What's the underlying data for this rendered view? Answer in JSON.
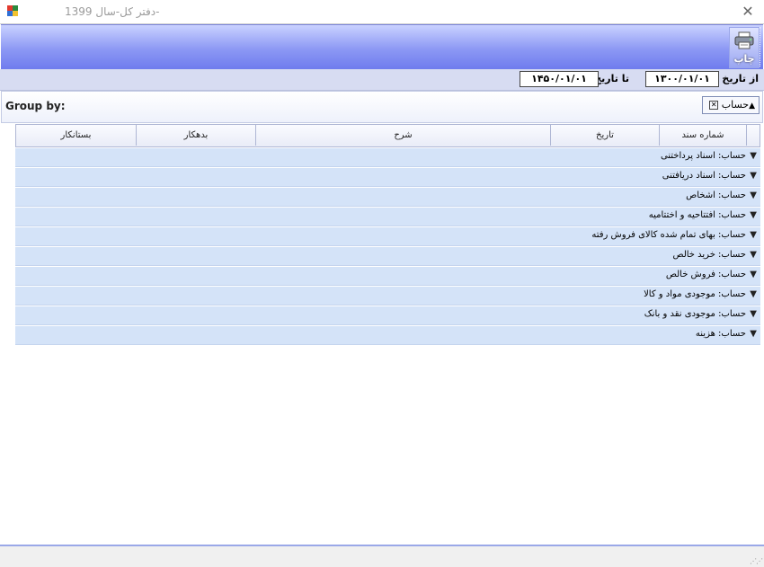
{
  "window": {
    "title": "دفتر کل-سال 1399-",
    "close_glyph": "✕"
  },
  "toolbar": {
    "print_label": "چاپ"
  },
  "filters": {
    "from_label": "از تاریخ",
    "from_value": "۱۳۰۰/۰۱/۰۱",
    "to_label": "تا تاریخ",
    "to_value": "۱۴۵۰/۰۱/۰۱"
  },
  "groupby": {
    "label": "Group by:",
    "chip_label": "حساب"
  },
  "grid": {
    "columns": [
      "شماره سند",
      "تاریخ",
      "شرح",
      "بدهکار",
      "بستانکار"
    ],
    "groups": [
      "حساب: اسناد پرداختنی",
      "حساب: اسناد دریافتنی",
      "حساب: اشخاص",
      "حساب: افتتاحیه و اختتامیه",
      "حساب: بهای تمام شده کالای فروش رفته",
      "حساب: خرید خالص",
      "حساب: فروش خالص",
      "حساب: موجودی مواد و کالا",
      "حساب: موجودی نقد و بانک",
      "حساب: هزینه"
    ]
  },
  "icons": {
    "app": "app-icon",
    "print": "printer-icon",
    "expand": "chevron-down-icon",
    "remove": "close-icon"
  }
}
